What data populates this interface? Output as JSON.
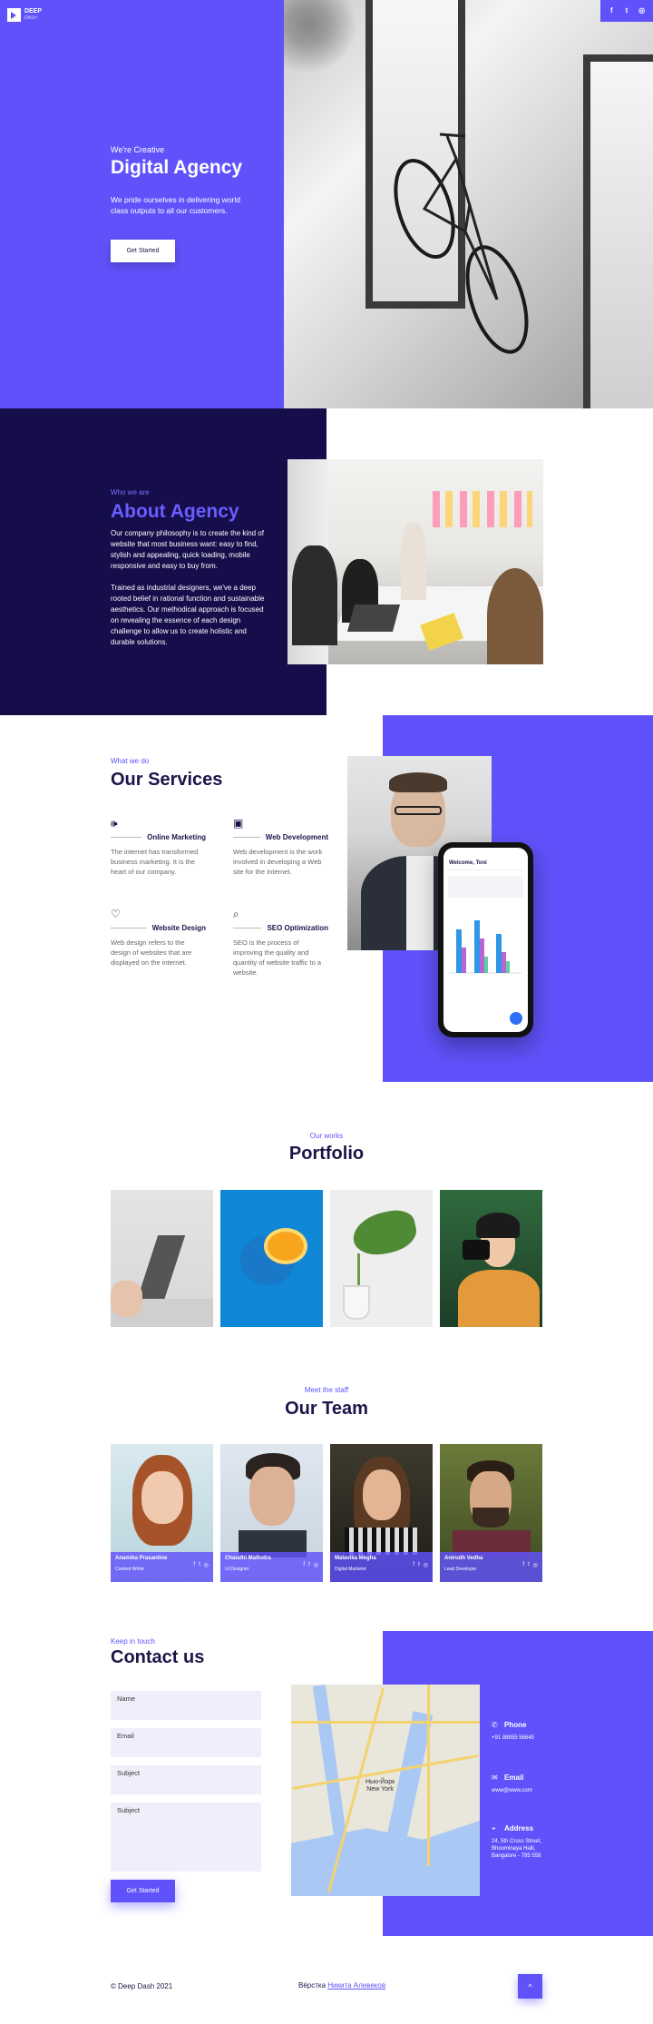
{
  "brand": {
    "name": "DEEP",
    "sub": "DASH"
  },
  "social": {
    "facebook": "f",
    "twitter": "t",
    "instagram": "◎"
  },
  "hero": {
    "eyebrow": "We're Creative",
    "title": "Digital Agency",
    "description": "We pride ourselves in delivering world class outputs to all our customers.",
    "button": "Get Started"
  },
  "about": {
    "eyebrow": "Who we are",
    "title": "About Agency",
    "p1": "Our company philosophy is to create the kind of website that most business want: easy to find, stylish and appealing, quick loading, mobile responsive and easy to buy from.",
    "p2": "Trained as industrial designers, we've a deep rooted belief in rational function and sustainable aesthetics. Our methodical approach is focused on revealing the essence of each design challenge to allow us to create holistic and durable solutions."
  },
  "services": {
    "eyebrow": "What we do",
    "title": "Our Services",
    "items": [
      {
        "icon": "megaphone-icon",
        "name": "Online Marketing",
        "desc": "The internet has transformed business marketing. It is the heart of our company."
      },
      {
        "icon": "layout-icon",
        "name": "Web Development",
        "desc": "Web development is the work involved in developing a Web site for the Internet."
      },
      {
        "icon": "heart-icon",
        "name": "Website Design",
        "desc": "Web design refers to the design of websites that are displayed on the internet."
      },
      {
        "icon": "search-icon",
        "name": "SEO Optimization",
        "desc": "SEO is the process of improving the quality and quantity of website traffic to a website."
      }
    ],
    "phone_header": "Welcome, Toni"
  },
  "portfolio": {
    "eyebrow": "Our works",
    "title": "Portfolio"
  },
  "team": {
    "eyebrow": "Meet the staff",
    "title": "Our Team",
    "members": [
      {
        "name": "Anamika Prasantine",
        "role": "Content Writer"
      },
      {
        "name": "Chaudhi Malhotra",
        "role": "UI Designer"
      },
      {
        "name": "Malavika Megha",
        "role": "Digital Marketer"
      },
      {
        "name": "Anirudh Vedha",
        "role": "Lead Developer"
      }
    ]
  },
  "contact": {
    "eyebrow": "Keep in touch",
    "title": "Contact us",
    "fields": {
      "name": "Name",
      "email": "Email",
      "subject": "Subject",
      "message": "Subject"
    },
    "button": "Get Started",
    "map_labels": {
      "city": "Нью-Йорк",
      "city_en": "New York"
    },
    "phone_label": "Phone",
    "phone_value": "+91 88855 56645",
    "email_label": "Email",
    "email_value": "www@www.com",
    "address_label": "Address",
    "address_value": "24, 5th Cross Street, Bhoominaya Halli, Bangalore - 785 558"
  },
  "footer": {
    "copyright": "© Deep Dash 2021",
    "credit_prefix": "Вёрстка",
    "credit_name": "Никита Алевеков",
    "top_button": "^"
  },
  "colors": {
    "accent": "#5f52fb",
    "dark": "#150e4b",
    "heading": "#1b1648"
  }
}
